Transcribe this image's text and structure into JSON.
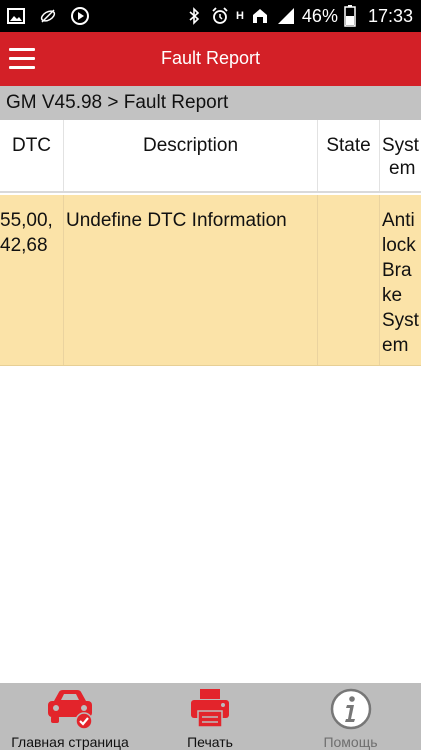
{
  "status_bar": {
    "battery": "46%",
    "time": "17:33",
    "network": "H"
  },
  "app_bar": {
    "title": "Fault Report",
    "menu_icon": "hamburger-menu-icon"
  },
  "breadcrumb": "GM V45.98 > Fault Report",
  "table": {
    "headers": {
      "dtc": "DTC",
      "description": "Description",
      "state": "State",
      "system_line1": "Syst",
      "system_line2": "em"
    },
    "rows": [
      {
        "dtc_line1": "55,00,",
        "dtc_line2": "42,68",
        "description": "Undefine DTC Information",
        "state": "",
        "system_lines": [
          "Anti",
          "lock",
          "Bra",
          "ke",
          "Syst",
          "em"
        ]
      }
    ]
  },
  "toolbar": {
    "home_label": "Главная страница",
    "print_label": "Печать",
    "help_label": "Помощь"
  },
  "colors": {
    "primary": "#d32027",
    "row_highlight": "#fbe3a8",
    "breadcrumb_bg": "#c2c2c2",
    "toolbar_bg": "#bdbdbd"
  }
}
